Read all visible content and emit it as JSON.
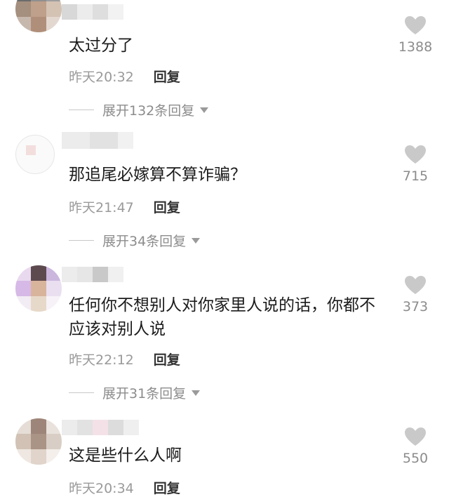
{
  "comments": [
    {
      "text": "太过分了",
      "time": "昨天20:32",
      "reply_label": "回复",
      "likes": "1388",
      "expand_label": "展开132条回复"
    },
    {
      "text": "那追尾必嫁算不算诈骗？",
      "time": "昨天21:47",
      "reply_label": "回复",
      "likes": "715",
      "expand_label": "展开34条回复"
    },
    {
      "text": "任何你不想别人对你家里人说的话，你都不应该对别人说",
      "time": "昨天22:12",
      "reply_label": "回复",
      "likes": "373",
      "expand_label": "展开31条回复"
    },
    {
      "text": "这是些什么人啊",
      "time": "昨天20:34",
      "reply_label": "回复",
      "likes": "550"
    }
  ],
  "colors": {
    "like_icon": "#c9c9c9",
    "meta": "#9a9a9a",
    "reply": "#333333"
  },
  "icons": {
    "like": "heart-icon",
    "expand": "triangle-down-icon"
  }
}
